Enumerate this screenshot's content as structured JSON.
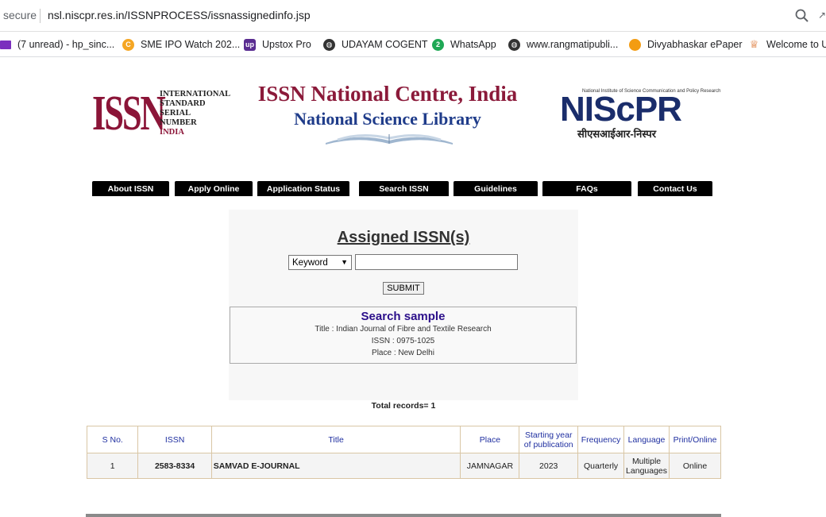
{
  "browser": {
    "secure_label": "secure",
    "url": "nsl.niscpr.res.in/ISSNPROCESS/issnassignedinfo.jsp",
    "bookmarks": [
      {
        "label": "(7 unread) - hp_sinc...",
        "icon": "mail-icon",
        "color": "#7b2fbe"
      },
      {
        "label": "SME IPO Watch 202...",
        "icon": "c-icon",
        "color": "#f5a623"
      },
      {
        "label": "Upstox Pro",
        "icon": "upstox-icon",
        "color": "#5a2d91"
      },
      {
        "label": "UDAYAM COGENT",
        "icon": "globe-icon",
        "color": "#333333"
      },
      {
        "label": "WhatsApp",
        "icon": "whatsapp-icon",
        "color": "#1fa855"
      },
      {
        "label": "www.rangmatipubli...",
        "icon": "globe-icon",
        "color": "#333333"
      },
      {
        "label": "Divyabhaskar ePaper",
        "icon": "circle-icon",
        "color": "#f39c12"
      },
      {
        "label": "Welcome to U",
        "icon": "emblem-icon",
        "color": "#d35400"
      }
    ]
  },
  "header": {
    "issn_logo_letters": "ISSN",
    "issn_logo_text": [
      "INTERNATIONAL",
      "STANDARD",
      "SERIAL",
      "NUMBER"
    ],
    "issn_logo_country": "INDIA",
    "title": "ISSN National Centre, India",
    "subtitle": "National Science Library",
    "niscpr_top": "National Institute of Science Communication and Policy Research",
    "niscpr_main": "NIScPR",
    "niscpr_hindi": "सीएसआईआर-निस्पर"
  },
  "nav": [
    "About ISSN",
    "Apply Online",
    "Application Status",
    "Search ISSN",
    "Guidelines",
    "FAQs",
    "Contact Us"
  ],
  "search": {
    "title": "Assigned ISSN(s)",
    "select_value": "Keyword",
    "input_value": "",
    "submit_label": "SUBMIT",
    "sample_title": "Search sample",
    "sample_lines": [
      "Title : Indian Journal of Fibre and Textile Research",
      "ISSN : 0975-1025",
      "Place : New Delhi"
    ],
    "total_records": "Total records= 1"
  },
  "table": {
    "headers": [
      "S No.",
      "ISSN",
      "Title",
      "Place",
      "Starting year of publication",
      "Frequency",
      "Language",
      "Print/Online"
    ],
    "rows": [
      [
        "1",
        "2583-8334",
        "SAMVAD E-JOURNAL",
        "JAMNAGAR",
        "2023",
        "Quarterly",
        "Multiple Languages",
        "Online"
      ]
    ]
  }
}
